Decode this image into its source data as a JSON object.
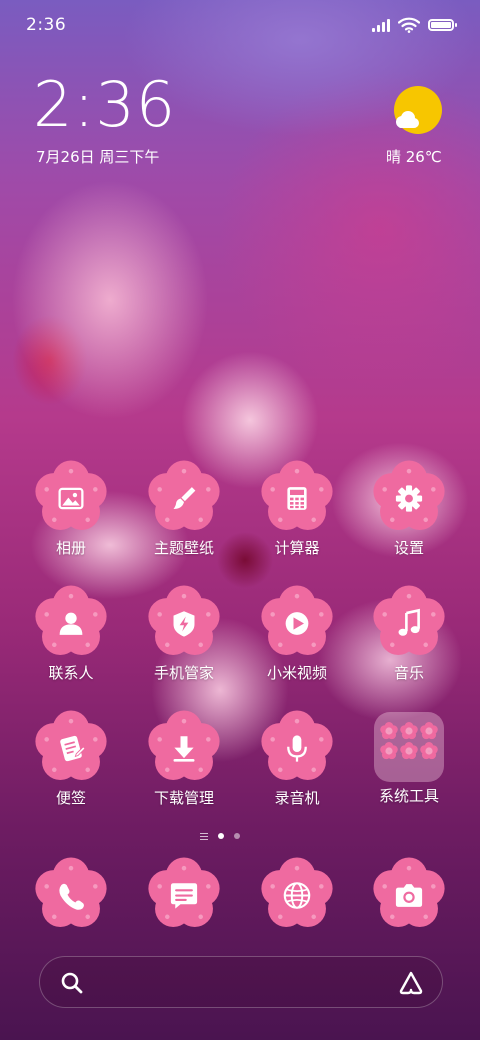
{
  "status_bar": {
    "time": "2:36",
    "battery_level": 1.0
  },
  "widget": {
    "clock": "2:36",
    "date": "7月26日 周三下午",
    "weather": "晴 26℃",
    "weather_icon": "sun-cloud-icon"
  },
  "apps": [
    {
      "label": "相册",
      "icon": "gallery-icon"
    },
    {
      "label": "主题壁纸",
      "icon": "paintbrush-icon"
    },
    {
      "label": "计算器",
      "icon": "calculator-icon"
    },
    {
      "label": "设置",
      "icon": "gear-icon"
    },
    {
      "label": "联系人",
      "icon": "person-icon"
    },
    {
      "label": "手机管家",
      "icon": "shield-icon"
    },
    {
      "label": "小米视频",
      "icon": "play-icon"
    },
    {
      "label": "音乐",
      "icon": "music-note-icon"
    },
    {
      "label": "便签",
      "icon": "note-icon"
    },
    {
      "label": "下载管理",
      "icon": "download-icon"
    },
    {
      "label": "录音机",
      "icon": "microphone-icon"
    },
    {
      "label": "系统工具",
      "icon": "folder-icon"
    }
  ],
  "page_indicator": {
    "pages": 2,
    "current": 1
  },
  "dock": [
    {
      "icon": "phone-icon"
    },
    {
      "icon": "message-icon"
    },
    {
      "icon": "browser-globe-icon"
    },
    {
      "icon": "camera-icon"
    }
  ],
  "search": {
    "left_icon": "search-icon",
    "right_icon": "assistant-icon"
  },
  "colors": {
    "flower": "#ef6aa0",
    "flower_dot": "#f7a2c4",
    "icon_fg": "#ffffff",
    "weather_sun": "#f7c600"
  }
}
